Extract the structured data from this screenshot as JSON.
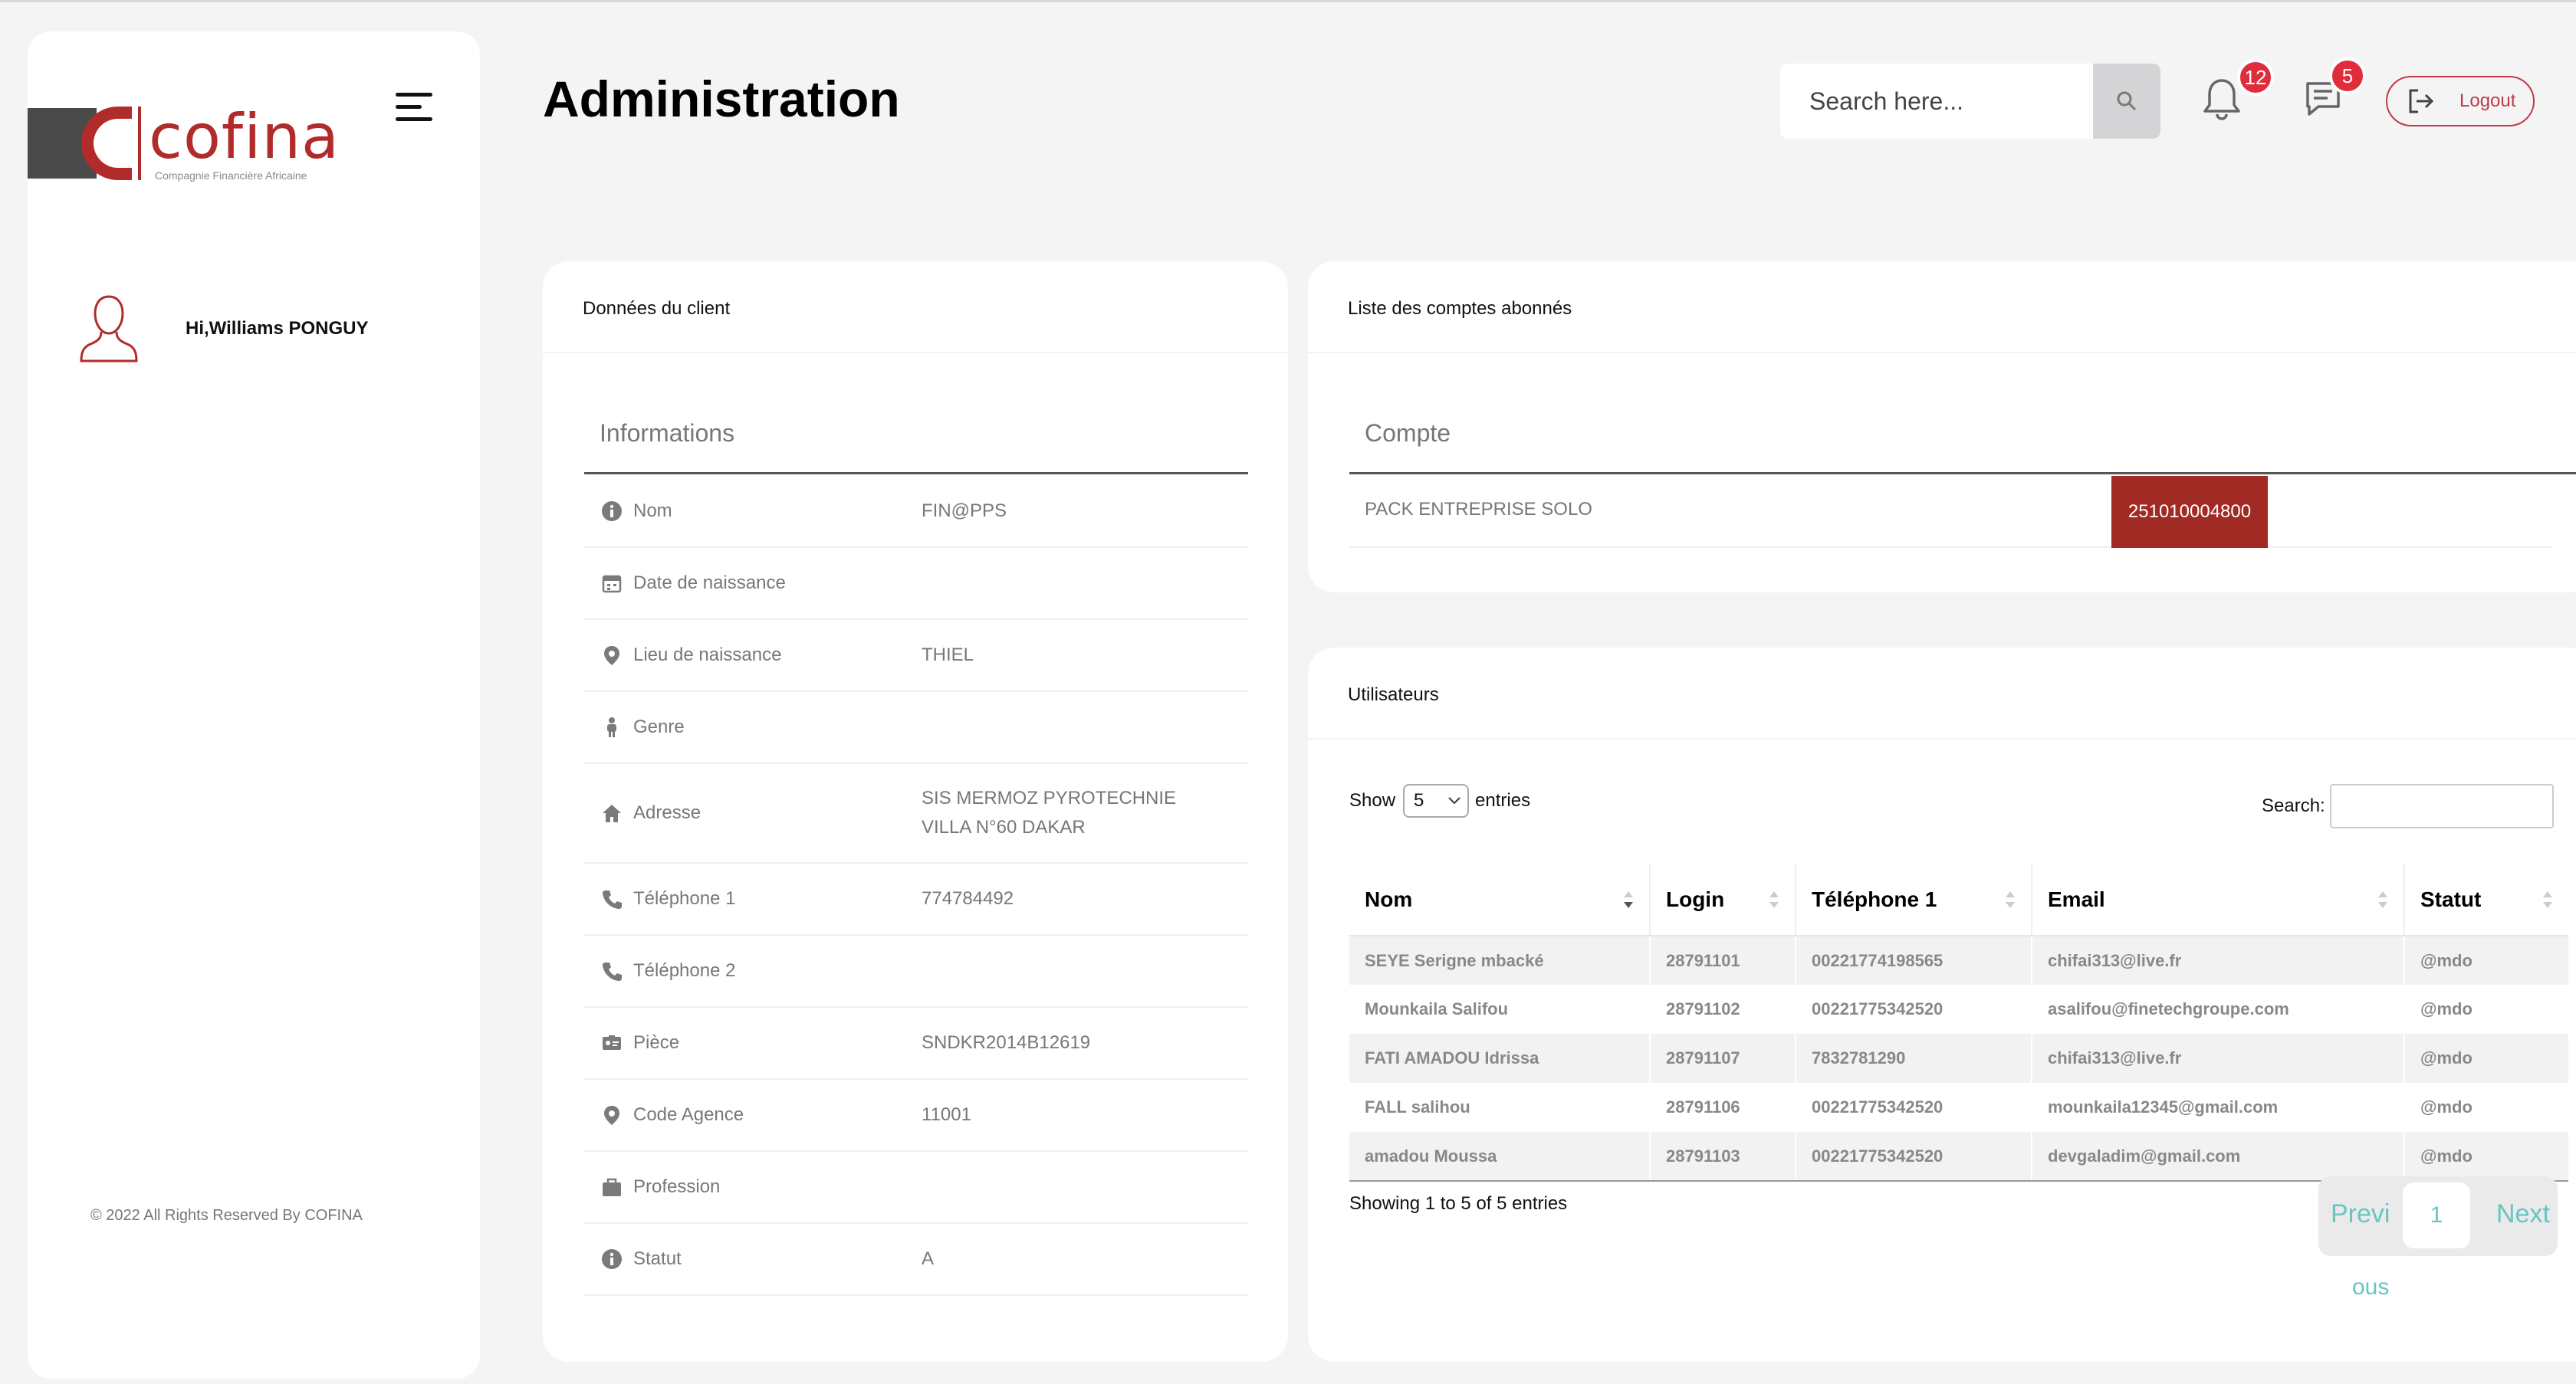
{
  "brand": {
    "name": "cofina",
    "tagline": "Compagnie Financière Africaine",
    "accent": "#b22b2b"
  },
  "sidebar": {
    "greeting": "Hi,Williams PONGUY",
    "copyright": "© 2022 All Rights Reserved By COFINA",
    "menu_icon": "hamburger-icon",
    "avatar_icon": "user-outline-icon"
  },
  "header": {
    "title": "Administration",
    "search_placeholder": "Search here...",
    "notifications_count": "12",
    "messages_count": "5",
    "logout_label": "Logout"
  },
  "client_card": {
    "title": "Données du client",
    "section_label": "Informations",
    "rows": [
      {
        "icon": "info-icon",
        "label": "Nom",
        "value": "FIN@PPS"
      },
      {
        "icon": "calendar-icon",
        "label": "Date de naissance",
        "value": ""
      },
      {
        "icon": "location-pin-icon",
        "label": "Lieu de naissance",
        "value": "THIEL"
      },
      {
        "icon": "person-icon",
        "label": "Genre",
        "value": ""
      },
      {
        "icon": "home-icon",
        "label": "Adresse",
        "value": "SIS MERMOZ PYROTECHNIE VILLA N°60 DAKAR"
      },
      {
        "icon": "phone-icon",
        "label": "Téléphone 1",
        "value": "774784492"
      },
      {
        "icon": "phone-icon",
        "label": "Téléphone 2",
        "value": ""
      },
      {
        "icon": "id-card-icon",
        "label": "Pièce",
        "value": "SNDKR2014B12619"
      },
      {
        "icon": "location-pin-icon",
        "label": "Code Agence",
        "value": "11001"
      },
      {
        "icon": "briefcase-icon",
        "label": "Profession",
        "value": ""
      },
      {
        "icon": "info-icon",
        "label": "Statut",
        "value": "A"
      }
    ]
  },
  "accounts_card": {
    "title": "Liste des comptes abonnés",
    "column_label": "Compte",
    "account_name": "PACK ENTREPRISE SOLO",
    "account_number": "251010004800"
  },
  "users_card": {
    "title": "Utilisateurs",
    "show_label": "Show",
    "entries_value": "5",
    "entries_label": "entries",
    "search_label": "Search:",
    "columns": [
      "Nom",
      "Login",
      "Téléphone 1",
      "Email",
      "Statut"
    ],
    "rows": [
      [
        "SEYE Serigne mbacké",
        "28791101",
        "00221774198565",
        "chifai313@live.fr",
        "@mdo"
      ],
      [
        "Mounkaila Salifou",
        "28791102",
        "00221775342520",
        "asalifou@finetechgroupe.com",
        "@mdo"
      ],
      [
        "FATI AMADOU Idrissa",
        "28791107",
        "7832781290",
        "chifai313@live.fr",
        "@mdo"
      ],
      [
        "FALL salihou",
        "28791106",
        "00221775342520",
        "mounkaila12345@gmail.com",
        "@mdo"
      ],
      [
        "amadou Moussa",
        "28791103",
        "00221775342520",
        "devgaladim@gmail.com",
        "@mdo"
      ]
    ],
    "showing_info": "Showing 1 to 5 of 5 entries",
    "pager_prev": "Previ",
    "pager_prev_wrap": "ous",
    "pager_page": "1",
    "pager_next": "Next"
  }
}
